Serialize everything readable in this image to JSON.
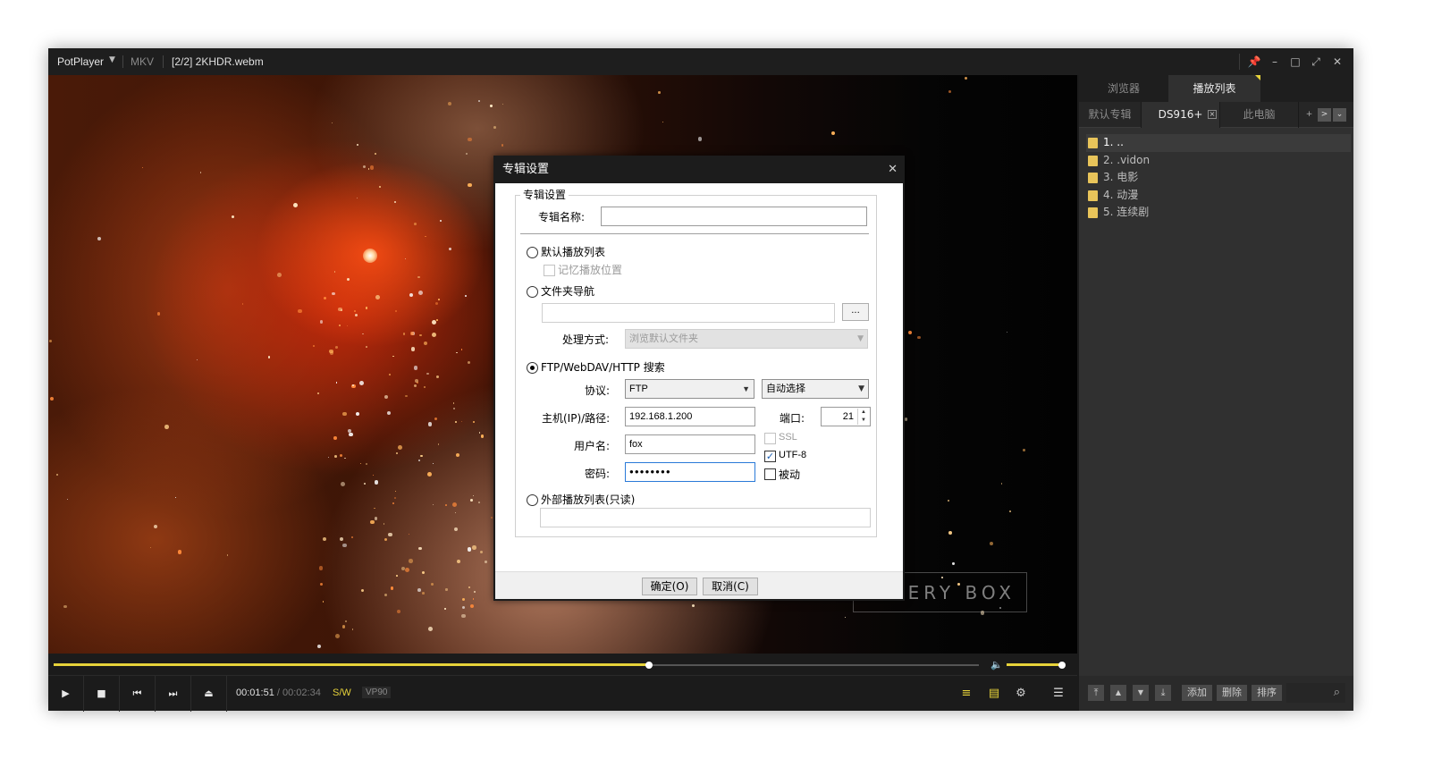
{
  "titlebar": {
    "app_name": "PotPlayer",
    "format": "MKV",
    "file_title": "[2/2] 2KHDR.webm",
    "buttons": {
      "pin": "📌",
      "minimize": "–",
      "maximize": "□",
      "fullscreen": "⤢",
      "close": "✕"
    }
  },
  "video": {
    "watermark_text": "TERY BOX"
  },
  "seekbar": {
    "progress_fraction": 0.643,
    "volume_fraction": 1.0
  },
  "controls": {
    "play_icon": "▶",
    "stop_icon": "■",
    "prev_icon": "⏮",
    "next_icon": "⏭",
    "eject_icon": "⏏",
    "time_current": "00:01:51",
    "time_separator": "/",
    "time_total": "00:02:34",
    "decoder_badge": "S/W",
    "codec_badge": "VP90",
    "playlist_icon": "≡",
    "subtitle_icon": "▤",
    "settings_icon": "⚙",
    "menu_icon": "☰",
    "accent_color": "#e6d23a"
  },
  "panel": {
    "tabs": [
      {
        "label": "浏览器"
      },
      {
        "label": "播放列表"
      }
    ],
    "subtabs": [
      {
        "label": "默认专辑"
      },
      {
        "label": "DS916+"
      },
      {
        "label": "此电脑"
      }
    ],
    "subtab_close": "×",
    "subtab_add": "+",
    "subtab_next": ">",
    "subtab_menu": "⌄",
    "items": [
      {
        "label": "1. .."
      },
      {
        "label": "2. .vidon"
      },
      {
        "label": "3. 电影"
      },
      {
        "label": "4. 动漫"
      },
      {
        "label": "5. 连续剧"
      }
    ],
    "bottom": {
      "move_top": "⤒",
      "move_up": "▲",
      "move_down": "▼",
      "move_bottom": "⤓",
      "add": "添加",
      "delete": "删除",
      "sort": "排序",
      "search_icon": "⌕"
    }
  },
  "dialog": {
    "title": "专辑设置",
    "close": "✕",
    "group_title": "专辑设置",
    "album_name_label": "专辑名称:",
    "album_name_value": "",
    "opt_default_playlist": "默认播放列表",
    "remember_position": "记忆播放位置",
    "opt_folder_nav": "文件夹导航",
    "folder_path_value": "",
    "browse_button": "...",
    "process_mode_label": "处理方式:",
    "process_mode_value": "浏览默认文件夹",
    "opt_ftp": "FTP/WebDAV/HTTP 搜索",
    "protocol_label": "协议:",
    "protocol_value": "FTP",
    "encoding_value": "自动选择",
    "host_label": "主机(IP)/路径:",
    "host_value": "192.168.1.200",
    "port_label": "端口:",
    "port_value": "21",
    "user_label": "用户名:",
    "user_value": "fox",
    "password_label": "密码:",
    "password_value": "●●●●●●●●",
    "ssl_label": "SSL",
    "utf8_label": "UTF-8",
    "passive_label": "被动",
    "opt_external": "外部播放列表(只读)",
    "external_value": "",
    "ok_button": "确定(O)",
    "cancel_button": "取消(C)",
    "selected_option": "ftp",
    "ssl_checked": false,
    "utf8_checked": true,
    "passive_checked": false
  }
}
